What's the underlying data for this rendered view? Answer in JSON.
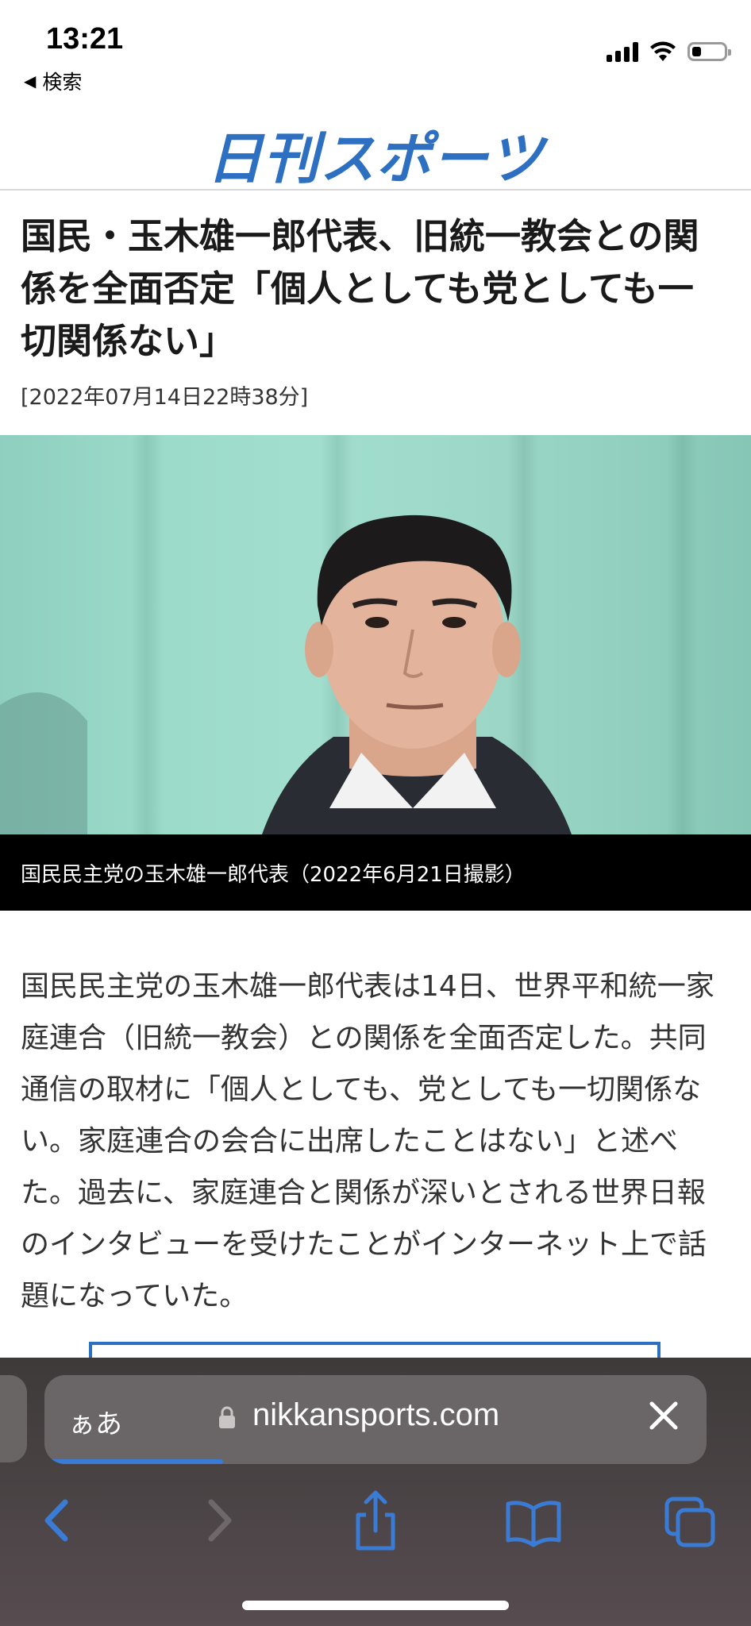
{
  "status": {
    "time": "13:21",
    "back_label": "検索",
    "signal_bars": 4,
    "battery_level": 0.3
  },
  "site": {
    "logo_text": "日刊スポーツ",
    "brand_color": "#2d6fc0"
  },
  "article": {
    "headline": "国民・玉木雄一郎代表、旧統一教会との関係を全面否定「個人としても党としても一切関係ない」",
    "date": "[2022年07月14日22時38分]",
    "photo_caption": "国民民主党の玉木雄一郎代表（2022年6月21日撮影）",
    "body": "国民民主党の玉木雄一郎代表は14日、世界平和統一家庭連合（旧統一教会）との関係を全面否定した。共同通信の取材に「個人としても、党としても一切関係ない。家庭連合の会合に出席したことはない」と述べた。過去に、家庭連合と関係が深いとされる世界日報のインタビューを受けたことがインターネット上で話題になっていた。"
  },
  "browser": {
    "aa_label": "ぁあ",
    "url": "nikkansports.com",
    "load_progress": 0.27,
    "accent_color": "#3a7bd5",
    "nav_icons": [
      "back-icon",
      "forward-icon",
      "share-icon",
      "bookmarks-icon",
      "tabs-icon"
    ]
  }
}
